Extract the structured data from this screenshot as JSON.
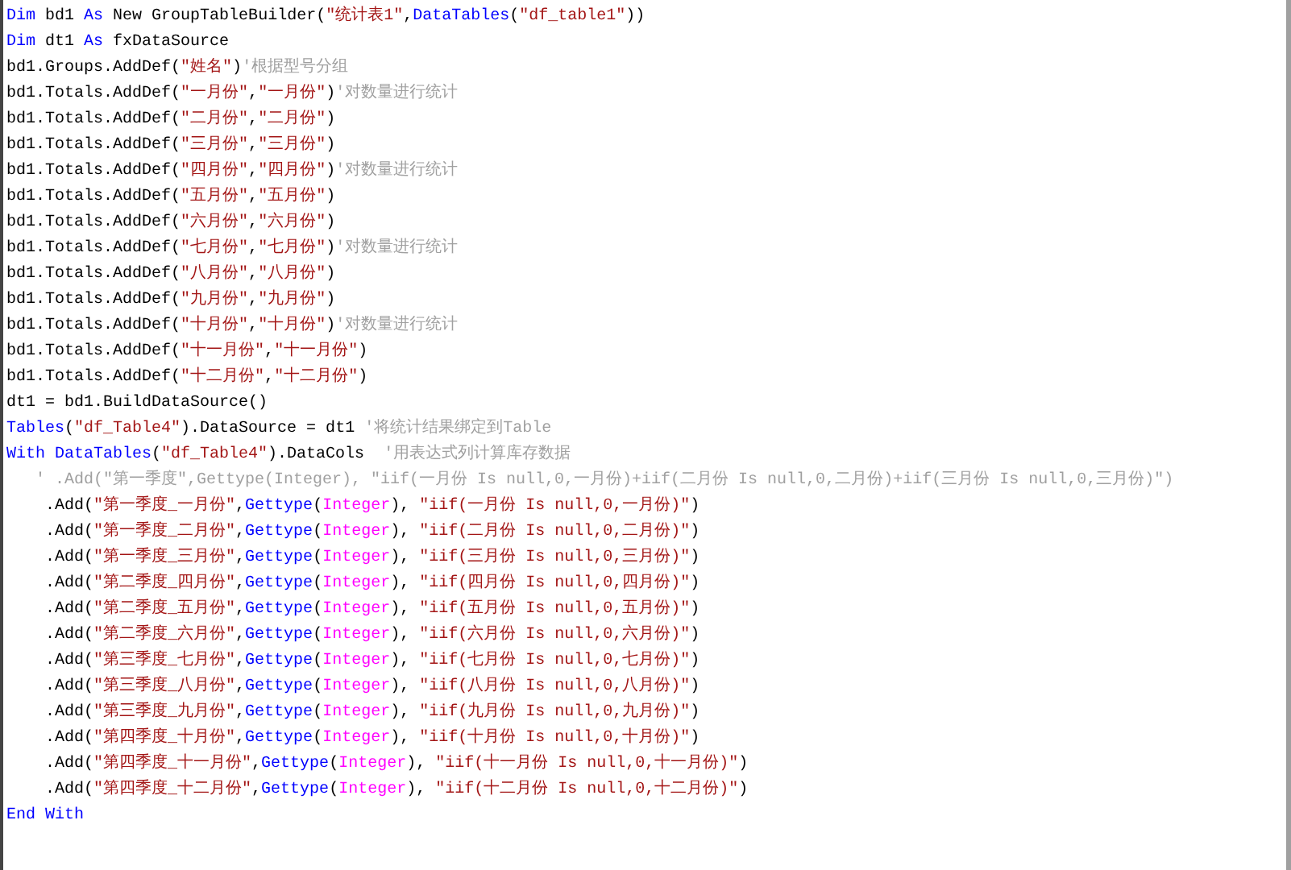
{
  "editor": {
    "lines": [
      [
        {
          "kind": "keyword",
          "text": "Dim"
        },
        {
          "kind": "plain",
          "text": " bd1 "
        },
        {
          "kind": "keyword",
          "text": "As"
        },
        {
          "kind": "plain",
          "text": " New GroupTableBuilder("
        },
        {
          "kind": "string",
          "text": "\"统计表1\""
        },
        {
          "kind": "plain",
          "text": ","
        },
        {
          "kind": "keyword",
          "text": "DataTables"
        },
        {
          "kind": "plain",
          "text": "("
        },
        {
          "kind": "string",
          "text": "\"df_table1\""
        },
        {
          "kind": "plain",
          "text": "))"
        }
      ],
      [
        {
          "kind": "keyword",
          "text": "Dim"
        },
        {
          "kind": "plain",
          "text": " dt1 "
        },
        {
          "kind": "keyword",
          "text": "As"
        },
        {
          "kind": "plain",
          "text": " fxDataSource"
        }
      ],
      [
        {
          "kind": "plain",
          "text": "bd1.Groups.AddDef("
        },
        {
          "kind": "string",
          "text": "\"姓名\""
        },
        {
          "kind": "plain",
          "text": ")"
        },
        {
          "kind": "comment",
          "text": "'根据型号分组"
        }
      ],
      [
        {
          "kind": "plain",
          "text": "bd1.Totals.AddDef("
        },
        {
          "kind": "string",
          "text": "\"一月份\""
        },
        {
          "kind": "plain",
          "text": ","
        },
        {
          "kind": "string",
          "text": "\"一月份\""
        },
        {
          "kind": "plain",
          "text": ")"
        },
        {
          "kind": "comment",
          "text": "'对数量进行统计"
        }
      ],
      [
        {
          "kind": "plain",
          "text": "bd1.Totals.AddDef("
        },
        {
          "kind": "string",
          "text": "\"二月份\""
        },
        {
          "kind": "plain",
          "text": ","
        },
        {
          "kind": "string",
          "text": "\"二月份\""
        },
        {
          "kind": "plain",
          "text": ")"
        }
      ],
      [
        {
          "kind": "plain",
          "text": "bd1.Totals.AddDef("
        },
        {
          "kind": "string",
          "text": "\"三月份\""
        },
        {
          "kind": "plain",
          "text": ","
        },
        {
          "kind": "string",
          "text": "\"三月份\""
        },
        {
          "kind": "plain",
          "text": ")"
        }
      ],
      [
        {
          "kind": "plain",
          "text": "bd1.Totals.AddDef("
        },
        {
          "kind": "string",
          "text": "\"四月份\""
        },
        {
          "kind": "plain",
          "text": ","
        },
        {
          "kind": "string",
          "text": "\"四月份\""
        },
        {
          "kind": "plain",
          "text": ")"
        },
        {
          "kind": "comment",
          "text": "'对数量进行统计"
        }
      ],
      [
        {
          "kind": "plain",
          "text": "bd1.Totals.AddDef("
        },
        {
          "kind": "string",
          "text": "\"五月份\""
        },
        {
          "kind": "plain",
          "text": ","
        },
        {
          "kind": "string",
          "text": "\"五月份\""
        },
        {
          "kind": "plain",
          "text": ")"
        }
      ],
      [
        {
          "kind": "plain",
          "text": "bd1.Totals.AddDef("
        },
        {
          "kind": "string",
          "text": "\"六月份\""
        },
        {
          "kind": "plain",
          "text": ","
        },
        {
          "kind": "string",
          "text": "\"六月份\""
        },
        {
          "kind": "plain",
          "text": ")"
        }
      ],
      [
        {
          "kind": "plain",
          "text": "bd1.Totals.AddDef("
        },
        {
          "kind": "string",
          "text": "\"七月份\""
        },
        {
          "kind": "plain",
          "text": ","
        },
        {
          "kind": "string",
          "text": "\"七月份\""
        },
        {
          "kind": "plain",
          "text": ")"
        },
        {
          "kind": "comment",
          "text": "'对数量进行统计"
        }
      ],
      [
        {
          "kind": "plain",
          "text": "bd1.Totals.AddDef("
        },
        {
          "kind": "string",
          "text": "\"八月份\""
        },
        {
          "kind": "plain",
          "text": ","
        },
        {
          "kind": "string",
          "text": "\"八月份\""
        },
        {
          "kind": "plain",
          "text": ")"
        }
      ],
      [
        {
          "kind": "plain",
          "text": "bd1.Totals.AddDef("
        },
        {
          "kind": "string",
          "text": "\"九月份\""
        },
        {
          "kind": "plain",
          "text": ","
        },
        {
          "kind": "string",
          "text": "\"九月份\""
        },
        {
          "kind": "plain",
          "text": ")"
        }
      ],
      [
        {
          "kind": "plain",
          "text": "bd1.Totals.AddDef("
        },
        {
          "kind": "string",
          "text": "\"十月份\""
        },
        {
          "kind": "plain",
          "text": ","
        },
        {
          "kind": "string",
          "text": "\"十月份\""
        },
        {
          "kind": "plain",
          "text": ")"
        },
        {
          "kind": "comment",
          "text": "'对数量进行统计"
        }
      ],
      [
        {
          "kind": "plain",
          "text": "bd1.Totals.AddDef("
        },
        {
          "kind": "string",
          "text": "\"十一月份\""
        },
        {
          "kind": "plain",
          "text": ","
        },
        {
          "kind": "string",
          "text": "\"十一月份\""
        },
        {
          "kind": "plain",
          "text": ")"
        }
      ],
      [
        {
          "kind": "plain",
          "text": "bd1.Totals.AddDef("
        },
        {
          "kind": "string",
          "text": "\"十二月份\""
        },
        {
          "kind": "plain",
          "text": ","
        },
        {
          "kind": "string",
          "text": "\"十二月份\""
        },
        {
          "kind": "plain",
          "text": ")"
        }
      ],
      [
        {
          "kind": "plain",
          "text": "dt1 = bd1.BuildDataSource()"
        }
      ],
      [
        {
          "kind": "keyword",
          "text": "Tables"
        },
        {
          "kind": "plain",
          "text": "("
        },
        {
          "kind": "string",
          "text": "\"df_Table4\""
        },
        {
          "kind": "plain",
          "text": ").DataSource = dt1 "
        },
        {
          "kind": "comment",
          "text": "'将统计结果绑定到Table"
        }
      ],
      [
        {
          "kind": "keyword",
          "text": "With DataTables"
        },
        {
          "kind": "plain",
          "text": "("
        },
        {
          "kind": "string",
          "text": "\"df_Table4\""
        },
        {
          "kind": "plain",
          "text": ").DataCols  "
        },
        {
          "kind": "comment",
          "text": "'用表达式列计算库存数据"
        }
      ],
      [
        {
          "kind": "comment",
          "text": "   ' .Add(\"第一季度\",Gettype(Integer), \"iif(一月份 Is null,0,一月份)+iif(二月份 Is null,0,二月份)+iif(三月份 Is null,0,三月份)\")"
        }
      ],
      [
        {
          "kind": "plain",
          "text": "    .Add("
        },
        {
          "kind": "string",
          "text": "\"第一季度_一月份\""
        },
        {
          "kind": "plain",
          "text": ","
        },
        {
          "kind": "keyword",
          "text": "Gettype"
        },
        {
          "kind": "plain",
          "text": "("
        },
        {
          "kind": "type",
          "text": "Integer"
        },
        {
          "kind": "plain",
          "text": "), "
        },
        {
          "kind": "string",
          "text": "\"iif(一月份 Is null,0,一月份)\""
        },
        {
          "kind": "plain",
          "text": ")"
        }
      ],
      [
        {
          "kind": "plain",
          "text": "    .Add("
        },
        {
          "kind": "string",
          "text": "\"第一季度_二月份\""
        },
        {
          "kind": "plain",
          "text": ","
        },
        {
          "kind": "keyword",
          "text": "Gettype"
        },
        {
          "kind": "plain",
          "text": "("
        },
        {
          "kind": "type",
          "text": "Integer"
        },
        {
          "kind": "plain",
          "text": "), "
        },
        {
          "kind": "string",
          "text": "\"iif(二月份 Is null,0,二月份)\""
        },
        {
          "kind": "plain",
          "text": ")"
        }
      ],
      [
        {
          "kind": "plain",
          "text": "    .Add("
        },
        {
          "kind": "string",
          "text": "\"第一季度_三月份\""
        },
        {
          "kind": "plain",
          "text": ","
        },
        {
          "kind": "keyword",
          "text": "Gettype"
        },
        {
          "kind": "plain",
          "text": "("
        },
        {
          "kind": "type",
          "text": "Integer"
        },
        {
          "kind": "plain",
          "text": "), "
        },
        {
          "kind": "string",
          "text": "\"iif(三月份 Is null,0,三月份)\""
        },
        {
          "kind": "plain",
          "text": ")"
        }
      ],
      [
        {
          "kind": "plain",
          "text": "    .Add("
        },
        {
          "kind": "string",
          "text": "\"第二季度_四月份\""
        },
        {
          "kind": "plain",
          "text": ","
        },
        {
          "kind": "keyword",
          "text": "Gettype"
        },
        {
          "kind": "plain",
          "text": "("
        },
        {
          "kind": "type",
          "text": "Integer"
        },
        {
          "kind": "plain",
          "text": "), "
        },
        {
          "kind": "string",
          "text": "\"iif(四月份 Is null,0,四月份)\""
        },
        {
          "kind": "plain",
          "text": ")"
        }
      ],
      [
        {
          "kind": "plain",
          "text": "    .Add("
        },
        {
          "kind": "string",
          "text": "\"第二季度_五月份\""
        },
        {
          "kind": "plain",
          "text": ","
        },
        {
          "kind": "keyword",
          "text": "Gettype"
        },
        {
          "kind": "plain",
          "text": "("
        },
        {
          "kind": "type",
          "text": "Integer"
        },
        {
          "kind": "plain",
          "text": "), "
        },
        {
          "kind": "string",
          "text": "\"iif(五月份 Is null,0,五月份)\""
        },
        {
          "kind": "plain",
          "text": ")"
        }
      ],
      [
        {
          "kind": "plain",
          "text": "    .Add("
        },
        {
          "kind": "string",
          "text": "\"第二季度_六月份\""
        },
        {
          "kind": "plain",
          "text": ","
        },
        {
          "kind": "keyword",
          "text": "Gettype"
        },
        {
          "kind": "plain",
          "text": "("
        },
        {
          "kind": "type",
          "text": "Integer"
        },
        {
          "kind": "plain",
          "text": "), "
        },
        {
          "kind": "string",
          "text": "\"iif(六月份 Is null,0,六月份)\""
        },
        {
          "kind": "plain",
          "text": ")"
        }
      ],
      [
        {
          "kind": "plain",
          "text": "    .Add("
        },
        {
          "kind": "string",
          "text": "\"第三季度_七月份\""
        },
        {
          "kind": "plain",
          "text": ","
        },
        {
          "kind": "keyword",
          "text": "Gettype"
        },
        {
          "kind": "plain",
          "text": "("
        },
        {
          "kind": "type",
          "text": "Integer"
        },
        {
          "kind": "plain",
          "text": "), "
        },
        {
          "kind": "string",
          "text": "\"iif(七月份 Is null,0,七月份)\""
        },
        {
          "kind": "plain",
          "text": ")"
        }
      ],
      [
        {
          "kind": "plain",
          "text": "    .Add("
        },
        {
          "kind": "string",
          "text": "\"第三季度_八月份\""
        },
        {
          "kind": "plain",
          "text": ","
        },
        {
          "kind": "keyword",
          "text": "Gettype"
        },
        {
          "kind": "plain",
          "text": "("
        },
        {
          "kind": "type",
          "text": "Integer"
        },
        {
          "kind": "plain",
          "text": "), "
        },
        {
          "kind": "string",
          "text": "\"iif(八月份 Is null,0,八月份)\""
        },
        {
          "kind": "plain",
          "text": ")"
        }
      ],
      [
        {
          "kind": "plain",
          "text": "    .Add("
        },
        {
          "kind": "string",
          "text": "\"第三季度_九月份\""
        },
        {
          "kind": "plain",
          "text": ","
        },
        {
          "kind": "keyword",
          "text": "Gettype"
        },
        {
          "kind": "plain",
          "text": "("
        },
        {
          "kind": "type",
          "text": "Integer"
        },
        {
          "kind": "plain",
          "text": "), "
        },
        {
          "kind": "string",
          "text": "\"iif(九月份 Is null,0,九月份)\""
        },
        {
          "kind": "plain",
          "text": ")"
        }
      ],
      [
        {
          "kind": "plain",
          "text": "    .Add("
        },
        {
          "kind": "string",
          "text": "\"第四季度_十月份\""
        },
        {
          "kind": "plain",
          "text": ","
        },
        {
          "kind": "keyword",
          "text": "Gettype"
        },
        {
          "kind": "plain",
          "text": "("
        },
        {
          "kind": "type",
          "text": "Integer"
        },
        {
          "kind": "plain",
          "text": "), "
        },
        {
          "kind": "string",
          "text": "\"iif(十月份 Is null,0,十月份)\""
        },
        {
          "kind": "plain",
          "text": ")"
        }
      ],
      [
        {
          "kind": "plain",
          "text": "    .Add("
        },
        {
          "kind": "string",
          "text": "\"第四季度_十一月份\""
        },
        {
          "kind": "plain",
          "text": ","
        },
        {
          "kind": "keyword",
          "text": "Gettype"
        },
        {
          "kind": "plain",
          "text": "("
        },
        {
          "kind": "type",
          "text": "Integer"
        },
        {
          "kind": "plain",
          "text": "), "
        },
        {
          "kind": "string",
          "text": "\"iif(十一月份 Is null,0,十一月份)\""
        },
        {
          "kind": "plain",
          "text": ")"
        }
      ],
      [
        {
          "kind": "plain",
          "text": "    .Add("
        },
        {
          "kind": "string",
          "text": "\"第四季度_十二月份\""
        },
        {
          "kind": "plain",
          "text": ","
        },
        {
          "kind": "keyword",
          "text": "Gettype"
        },
        {
          "kind": "plain",
          "text": "("
        },
        {
          "kind": "type",
          "text": "Integer"
        },
        {
          "kind": "plain",
          "text": "), "
        },
        {
          "kind": "string",
          "text": "\"iif(十二月份 Is null,0,十二月份)\""
        },
        {
          "kind": "plain",
          "text": ")"
        }
      ],
      [
        {
          "kind": "keyword",
          "text": "End With"
        }
      ]
    ]
  }
}
